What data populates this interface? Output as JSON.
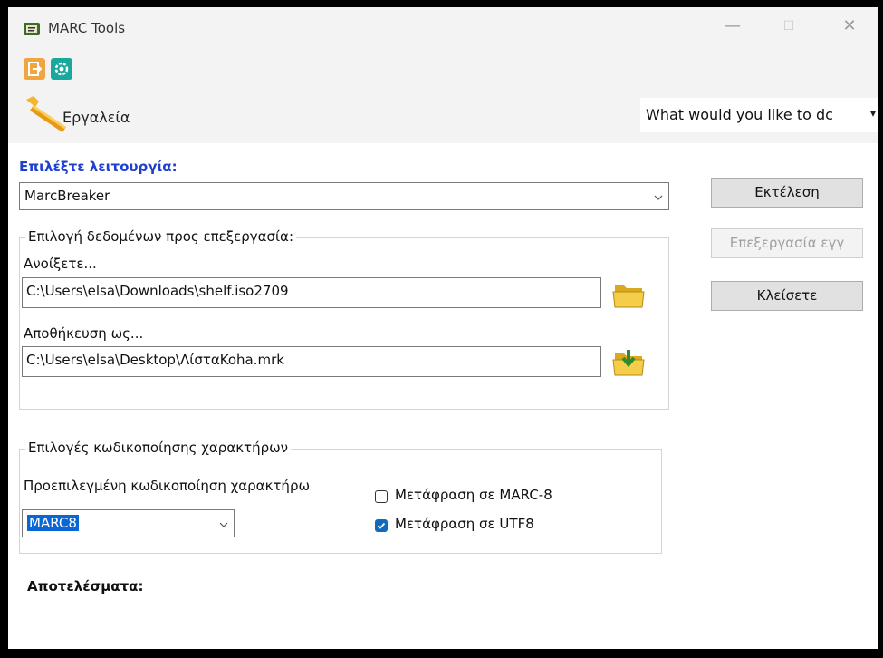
{
  "window": {
    "title": "MARC Tools",
    "controls": [
      "—",
      "☐",
      "✕"
    ]
  },
  "ribbon": {
    "tools_label": "Εργαλεία",
    "search_text": "What would you like to dc",
    "search_caret": "▾"
  },
  "main": {
    "choose_function_label": "Επιλέξτε λειτουργία:",
    "function_value": "MarcBreaker",
    "buttons": {
      "execute": "Εκτέλεση",
      "edit": "Επεξεργασία εγγ",
      "close": "Κλείσετε"
    },
    "data_group": {
      "title": "Επιλογή δεδομένων προς επεξεργασία:",
      "open_label": "Ανοίξετε...",
      "open_value": "C:\\Users\\elsa\\Downloads\\shelf.iso2709",
      "save_label": "Αποθήκευση ως...",
      "save_value": "C:\\Users\\elsa\\Desktop\\ΛίσταKoha.mrk"
    },
    "encoding_group": {
      "title": "Επιλογές κωδικοποίησης χαρακτήρων",
      "default_label": "Προεπιλεγμένη κωδικοποίηση χαρακτήρω",
      "default_value": "MARC8",
      "checkboxes": [
        {
          "label": "Μετάφραση σε MARC-8",
          "checked": false
        },
        {
          "label": "Μετάφραση σε UTF8",
          "checked": true
        }
      ]
    },
    "results_label": "Αποτελέσματα:"
  }
}
